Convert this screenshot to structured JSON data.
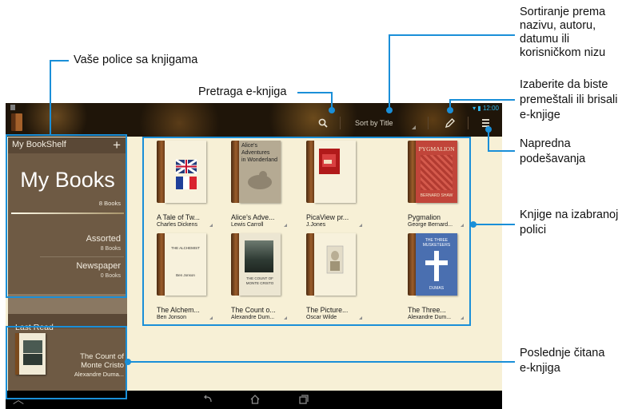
{
  "annotations": {
    "sort": [
      "Sortiranje prema",
      "nazivu, autoru,",
      "datumu ili",
      "korisničkom nizu"
    ],
    "shelves": "Vaše police sa knjigama",
    "search": "Pretraga e-knjiga",
    "edit": [
      "Izaberite da biste",
      "premeštali ili brisali",
      "e-knjige"
    ],
    "advanced": [
      "Napredna",
      "podešavanja"
    ],
    "books_on_shelf": [
      "Knjige na izabranoj",
      "polici"
    ],
    "last_read": [
      "Poslednje čitana",
      "e-knjiga"
    ]
  },
  "status_bar": {
    "time": "12:00"
  },
  "toolbar": {
    "sort_label": "Sort by Title"
  },
  "shelf_panel": {
    "header": "My BookShelf",
    "add_icon": "+",
    "current": {
      "name": "My Books",
      "count": "8 Books"
    },
    "others": [
      {
        "name": "Assorted",
        "count": "8 Books"
      },
      {
        "name": "Newspaper",
        "count": "0 Books"
      }
    ]
  },
  "last_read": {
    "header": "Last Read",
    "title": "The Count of Monte Cristo",
    "author": "Alexandre Duma..."
  },
  "books": [
    {
      "title": "A Tale of Tw...",
      "author": "Charles Dickens",
      "cover_icon": "flags-cover"
    },
    {
      "title": "Alice's Adve...",
      "author": "Lewis Carroll",
      "cover_text": [
        "Alice's",
        "Adventures",
        "in Wonderland"
      ]
    },
    {
      "title": "PicaView pr...",
      "author": "J.Jones",
      "cover_icon": "red-device-cover"
    },
    {
      "title": "Pygmalion",
      "author": "George Bernard...",
      "cover_text": [
        "PYGMALION",
        "BERNARD SHAW"
      ]
    },
    {
      "title": "The Alchem...",
      "author": "Ben Jonson",
      "cover_text": [
        "THE ALCHEMIST",
        "Ben Jonson"
      ]
    },
    {
      "title": "The Count o...",
      "author": "Alexandre Dum...",
      "cover_text": [
        "THE COUNT OF",
        "MONTE CRISTO"
      ]
    },
    {
      "title": "The Picture...",
      "author": "Oscar Wilde",
      "cover_icon": "portrait-cover"
    },
    {
      "title": "The Three...",
      "author": "Alexandre Dum...",
      "cover_text": [
        "THE THREE",
        "MUSKETEERS",
        "DUMAS"
      ]
    }
  ],
  "colors": {
    "callout": "#1a8fd8",
    "shelf_panel": "#6e5a44",
    "content_bg": "#f7f0d6",
    "status": "#2fb7f0"
  }
}
